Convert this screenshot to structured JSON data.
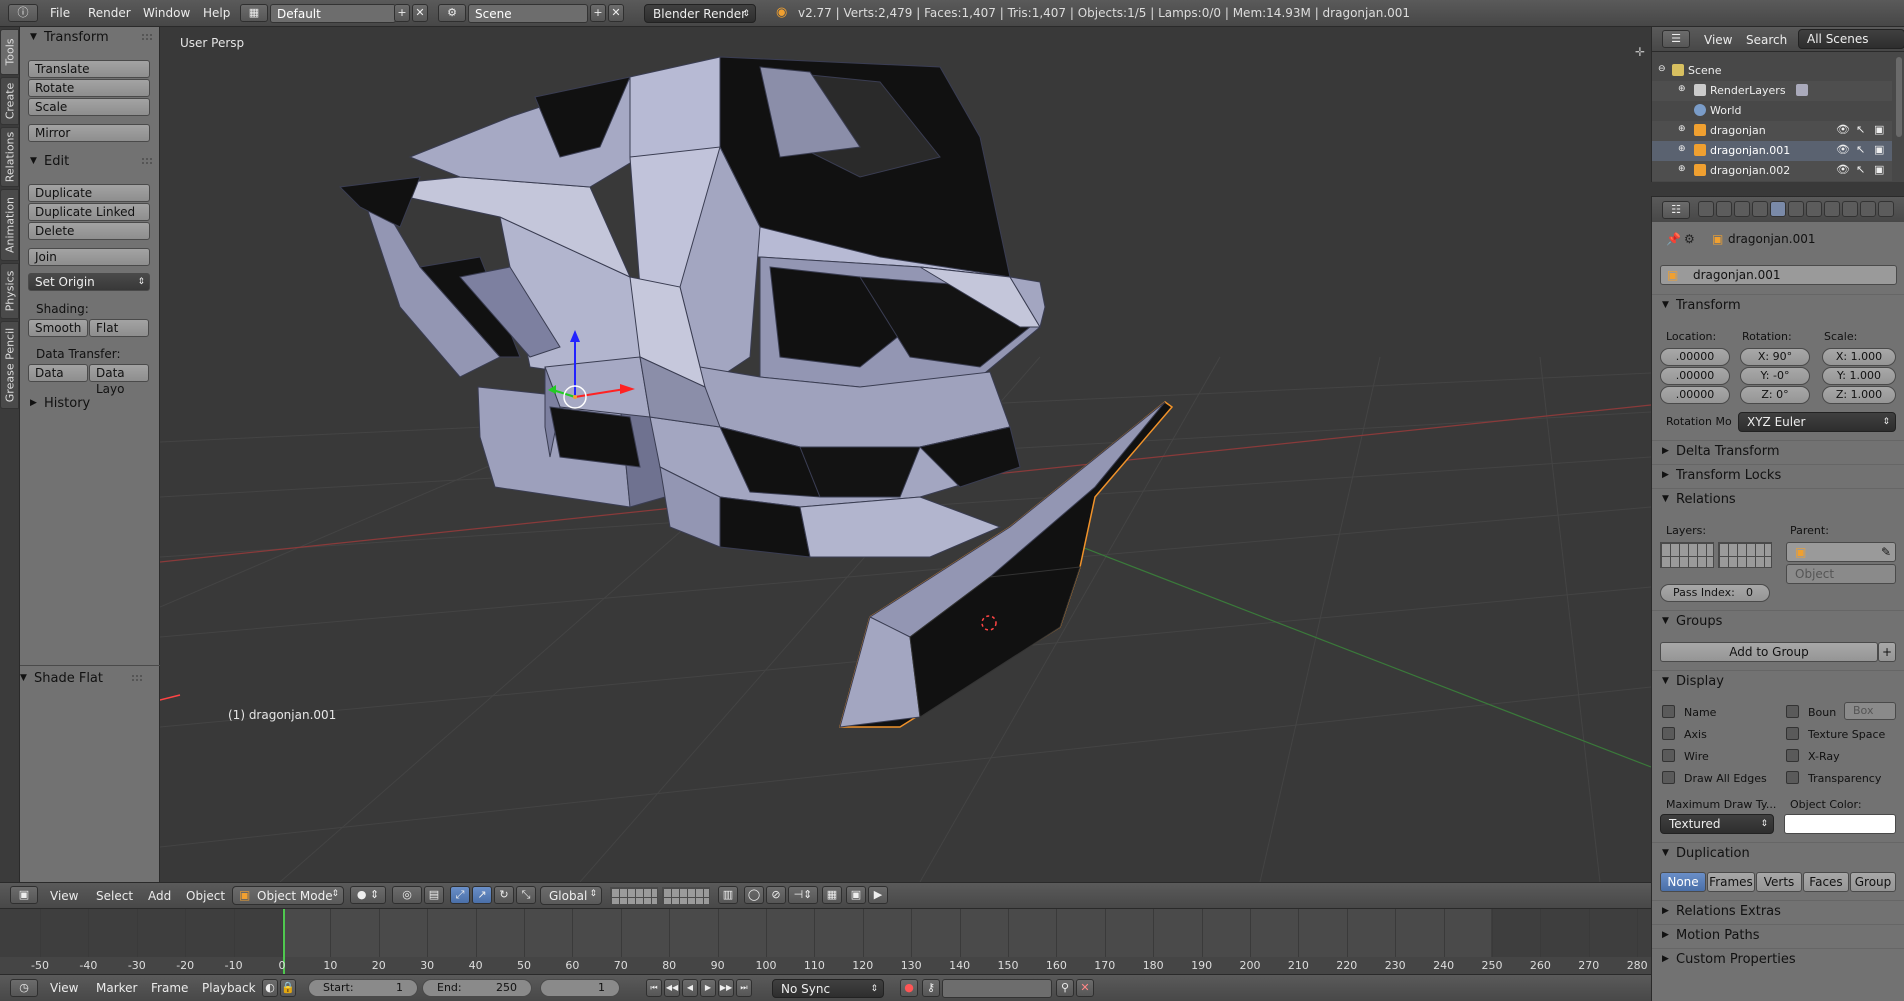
{
  "topbar": {
    "menus": [
      "File",
      "Render",
      "Window",
      "Help"
    ],
    "layout": "Default",
    "scene": "Scene",
    "engine": "Blender Render",
    "stats": "v2.77 | Verts:2,479 | Faces:1,407 | Tris:1,407 | Objects:1/5 | Lamps:0/0 | Mem:14.93M | dragonjan.001"
  },
  "vtabs": [
    "Tools",
    "Create",
    "Relations",
    "Animation",
    "Physics",
    "Grease Pencil"
  ],
  "toolshelf": {
    "transform_title": "Transform",
    "translate": "Translate",
    "rotate": "Rotate",
    "scale": "Scale",
    "mirror": "Mirror",
    "edit_title": "Edit",
    "duplicate": "Duplicate",
    "duplicate_linked": "Duplicate Linked",
    "delete": "Delete",
    "join": "Join",
    "set_origin": "Set Origin",
    "shading_label": "Shading:",
    "smooth": "Smooth",
    "flat": "Flat",
    "data_transfer_label": "Data Transfer:",
    "data": "Data",
    "data_layout": "Data Layo",
    "history_title": "History",
    "operator_title": "Shade Flat"
  },
  "viewport": {
    "view_label": "User Persp",
    "object_label": "(1) dragonjan.001"
  },
  "vpheader": {
    "menus": [
      "View",
      "Select",
      "Add",
      "Object"
    ],
    "mode": "Object Mode",
    "orientation": "Global"
  },
  "timeline": {
    "ticks": [
      "-50",
      "-40",
      "-30",
      "-20",
      "-10",
      "0",
      "10",
      "20",
      "30",
      "40",
      "50",
      "60",
      "70",
      "80",
      "90",
      "100",
      "110",
      "120",
      "130",
      "140",
      "150",
      "160",
      "170",
      "180",
      "190",
      "200",
      "210",
      "220",
      "230",
      "240",
      "250",
      "260",
      "270",
      "280"
    ],
    "menus": [
      "View",
      "Marker",
      "Frame",
      "Playback"
    ],
    "start_label": "Start:",
    "start_value": "1",
    "end_label": "End:",
    "end_value": "250",
    "current_frame": "1",
    "sync": "No Sync"
  },
  "outliner": {
    "menus": [
      "View",
      "Search"
    ],
    "filter": "All Scenes",
    "rows": [
      "Scene",
      "RenderLayers",
      "World",
      "dragonjan",
      "dragonjan.001",
      "dragonjan.002"
    ]
  },
  "properties": {
    "breadcrumb": "dragonjan.001",
    "object_name": "dragonjan.001",
    "transform_title": "Transform",
    "location_label": "Location:",
    "rotation_label": "Rotation:",
    "scale_label": "Scale:",
    "location": [
      ".00000",
      ".00000",
      ".00000"
    ],
    "rotation": [
      "X:  90°",
      "Y:  -0°",
      "Z:   0°"
    ],
    "scale": [
      "X: 1.000",
      "Y: 1.000",
      "Z: 1.000"
    ],
    "rotation_mode_label": "Rotation Mo",
    "rotation_mode": "XYZ Euler",
    "delta_transform": "Delta Transform",
    "transform_locks": "Transform Locks",
    "relations_title": "Relations",
    "layers_label": "Layers:",
    "parent_label": "Parent:",
    "parent_type": "Object",
    "pass_index_label": "Pass Index:",
    "pass_index": "0",
    "groups_title": "Groups",
    "add_to_group": "Add to Group",
    "display_title": "Display",
    "display_checks": [
      "Name",
      "Axis",
      "Wire",
      "Draw All Edges"
    ],
    "display_checks_right": [
      "Boun",
      "Texture Space",
      "X-Ray",
      "Transparency"
    ],
    "bounds_type": "Box",
    "max_draw_type_label": "Maximum Draw Ty...",
    "object_color_label": "Object Color:",
    "max_draw_type": "Textured",
    "duplication_title": "Duplication",
    "duplication_modes": [
      "None",
      "Frames",
      "Verts",
      "Faces",
      "Group"
    ],
    "relations_extras": "Relations Extras",
    "motion_paths": "Motion Paths",
    "custom_properties": "Custom Properties"
  }
}
